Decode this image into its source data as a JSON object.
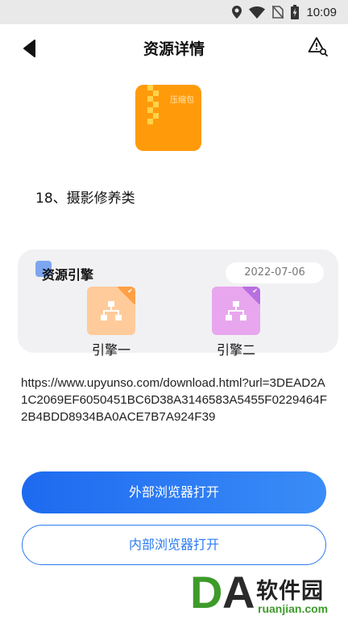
{
  "status_bar": {
    "time": "10:09",
    "icons": [
      "location-icon",
      "wifi-icon",
      "no-sim-icon",
      "battery-charging-icon"
    ]
  },
  "header": {
    "title": "资源详情",
    "back_icon": "back-arrow-icon",
    "report_icon": "warning-search-icon"
  },
  "file": {
    "type_label": "压缩包",
    "name": "18、摄影修养类"
  },
  "engine_panel": {
    "title": "资源引擎",
    "date": "2022-07-06",
    "engines": [
      {
        "label": "引擎一",
        "color": "#ffcb9a",
        "accent": "#ff9f45"
      },
      {
        "label": "引擎二",
        "color": "#e8a6ee",
        "accent": "#b86fe0"
      }
    ]
  },
  "url": "https://www.upyunso.com/download.html?url=3DEAD2A1C2069EF6050451BC6D38A3146583A5455F0229464F2B4BDD8934BA0ACE7B7A924F39",
  "buttons": {
    "external": "外部浏览器打开",
    "internal": "内部浏览器打开"
  },
  "watermark": {
    "cn": "软件园",
    "en": "ruanjian.com"
  },
  "colors": {
    "primary": "#2c7bf1",
    "file_icon": "#ff9b0b",
    "card_bg": "#f1f1f3"
  }
}
